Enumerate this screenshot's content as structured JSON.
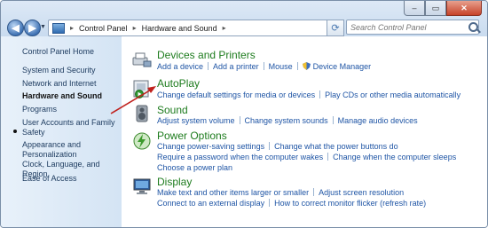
{
  "window": {
    "minimize": "–",
    "maximize": "▭",
    "close": "✕"
  },
  "nav": {
    "back": "◀",
    "forward": "▶",
    "history": "▼",
    "refresh": "⟳"
  },
  "address": {
    "crumbs": [
      "Control Panel",
      "Hardware and Sound"
    ],
    "separator": "▸",
    "dropdown": "▼"
  },
  "search": {
    "placeholder": "Search Control Panel"
  },
  "sidebar": {
    "items": [
      {
        "label": "Control Panel Home"
      },
      {
        "label": "System and Security"
      },
      {
        "label": "Network and Internet"
      },
      {
        "label": "Hardware and Sound"
      },
      {
        "label": "Programs"
      },
      {
        "label": "User Accounts and Family Safety"
      },
      {
        "label": "Appearance and Personalization"
      },
      {
        "label": "Clock, Language, and Region"
      },
      {
        "label": "Ease of Access"
      }
    ]
  },
  "categories": [
    {
      "title": "Devices and Printers",
      "icon": "printer-icon",
      "rows": [
        [
          "Add a device",
          "Add a printer",
          "Mouse",
          "Device Manager"
        ]
      ]
    },
    {
      "title": "AutoPlay",
      "icon": "autoplay-icon",
      "rows": [
        [
          "Change default settings for media or devices",
          "Play CDs or other media automatically"
        ]
      ]
    },
    {
      "title": "Sound",
      "icon": "speaker-icon",
      "rows": [
        [
          "Adjust system volume",
          "Change system sounds",
          "Manage audio devices"
        ]
      ]
    },
    {
      "title": "Power Options",
      "icon": "power-icon",
      "rows": [
        [
          "Change power-saving settings",
          "Change what the power buttons do"
        ],
        [
          "Require a password when the computer wakes",
          "Change when the computer sleeps"
        ],
        [
          "Choose a power plan"
        ]
      ]
    },
    {
      "title": "Display",
      "icon": "display-icon",
      "rows": [
        [
          "Make text and other items larger or smaller",
          "Adjust screen resolution"
        ],
        [
          "Connect to an external display",
          "How to correct monitor flicker (refresh rate)"
        ]
      ]
    }
  ],
  "colors": {
    "category_title": "#1e7c1e",
    "link": "#1f55a5",
    "annotation_arrow": "#c0201c"
  }
}
